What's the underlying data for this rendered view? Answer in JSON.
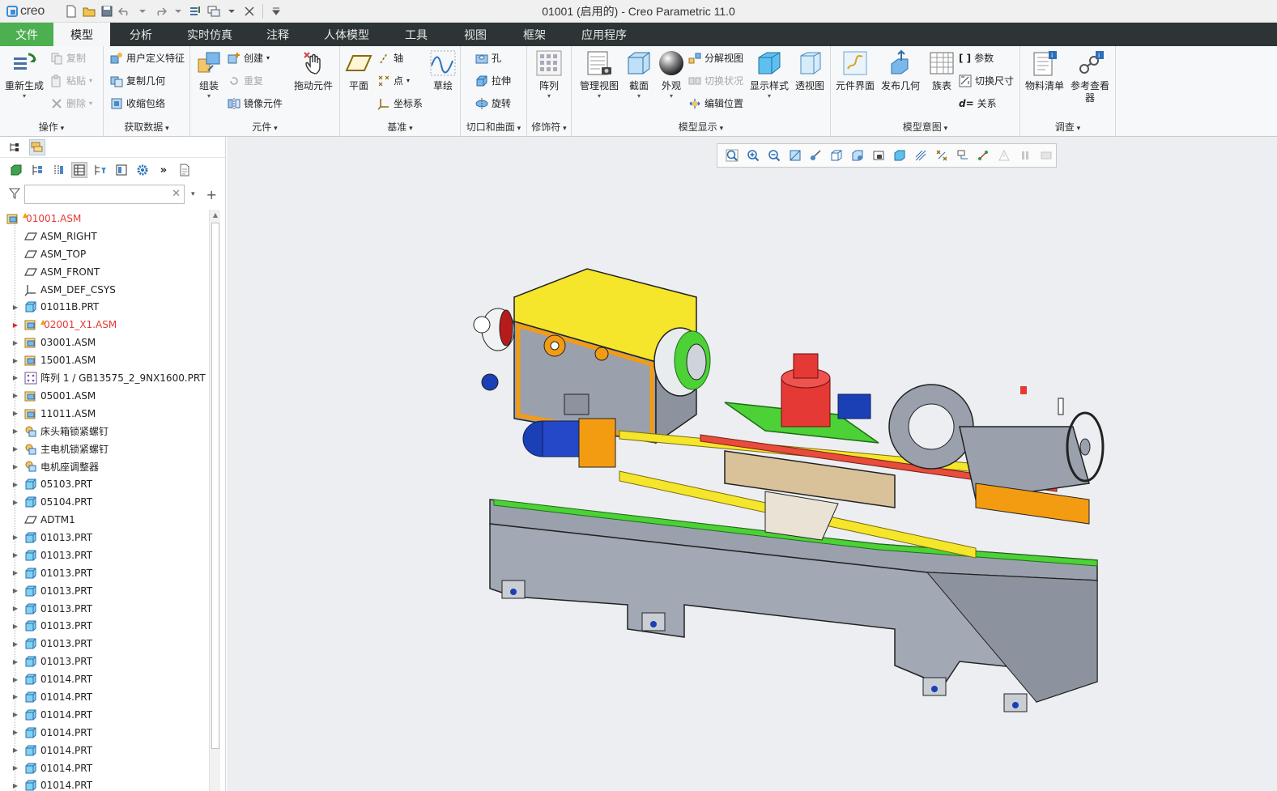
{
  "app": {
    "logo_text": "creo",
    "window_title": "01001 (启用的) - Creo Parametric 11.0"
  },
  "tabs": {
    "file": "文件",
    "items": [
      "模型",
      "分析",
      "实时仿真",
      "注释",
      "人体模型",
      "工具",
      "视图",
      "框架",
      "应用程序"
    ],
    "active": "模型"
  },
  "ribbon": {
    "operations": {
      "label": "操作",
      "regenerate": "重新生成",
      "copy": "复制",
      "paste": "粘贴",
      "delete": "删除"
    },
    "get_data": {
      "label": "获取数据",
      "user_feature": "用户定义特征",
      "copy_geometry": "复制几何",
      "shrinkwrap": "收缩包络"
    },
    "component": {
      "label": "元件",
      "assemble": "组装",
      "create": "创建",
      "repeat": "重复",
      "mirror_component": "镜像元件",
      "drag_components": "拖动元件"
    },
    "datum": {
      "label": "基准",
      "plane": "平面",
      "axis": "轴",
      "point": "点",
      "csys": "坐标系",
      "sketch": "草绘"
    },
    "cut_surface": {
      "label": "切口和曲面",
      "hole": "孔",
      "extrude": "拉伸",
      "revolve": "旋转"
    },
    "modifiers": {
      "label": "修饰符",
      "pattern": "阵列"
    },
    "model_display": {
      "label": "模型显示",
      "manage_views": "管理视图",
      "section": "截面",
      "appearance": "外观",
      "explode_view": "分解视图",
      "toggle_status": "切换状况",
      "edit_position": "编辑位置",
      "display_style": "显示样式",
      "perspective": "透视图"
    },
    "model_intent": {
      "label": "模型意图",
      "component_interface": "元件界面",
      "publish_geometry": "发布几何",
      "family_table": "族表",
      "parameters": "参数",
      "switch_dimensions": "切换尺寸",
      "relations": "关系"
    },
    "investigate": {
      "label": "调查",
      "bom": "物料清单",
      "reference_viewer": "参考查看器"
    }
  },
  "filter": {
    "placeholder": "",
    "value": ""
  },
  "tree": [
    {
      "label": "01001.ASM",
      "icon": "assembly-icon",
      "red": true,
      "warn": true,
      "root": true
    },
    {
      "label": "ASM_RIGHT",
      "icon": "datum-plane-icon"
    },
    {
      "label": "ASM_TOP",
      "icon": "datum-plane-icon"
    },
    {
      "label": "ASM_FRONT",
      "icon": "datum-plane-icon"
    },
    {
      "label": "ASM_DEF_CSYS",
      "icon": "csys-icon"
    },
    {
      "label": "01011B.PRT",
      "icon": "part-icon",
      "expand": true
    },
    {
      "label": "02001_X1.ASM",
      "icon": "assembly-icon",
      "expand": true,
      "red": true,
      "warn": true
    },
    {
      "label": "03001.ASM",
      "icon": "assembly-icon",
      "expand": true
    },
    {
      "label": "15001.ASM",
      "icon": "assembly-icon",
      "expand": true
    },
    {
      "label": "阵列 1 / GB13575_2_9NX1600.PRT",
      "icon": "pattern-icon",
      "expand": true
    },
    {
      "label": "05001.ASM",
      "icon": "assembly-icon",
      "expand": true
    },
    {
      "label": "11011.ASM",
      "icon": "assembly-icon",
      "expand": true
    },
    {
      "label": "床头箱锁紧螺钉",
      "icon": "group-icon",
      "expand": true
    },
    {
      "label": "主电机锁紧螺钉",
      "icon": "group-icon",
      "expand": true
    },
    {
      "label": "电机座调整器",
      "icon": "group-icon",
      "expand": true
    },
    {
      "label": "05103.PRT",
      "icon": "part-icon",
      "expand": true
    },
    {
      "label": "05104.PRT",
      "icon": "part-icon",
      "expand": true
    },
    {
      "label": "ADTM1",
      "icon": "datum-plane-icon"
    },
    {
      "label": "01013.PRT",
      "icon": "part-icon",
      "expand": true
    },
    {
      "label": "01013.PRT",
      "icon": "part-icon",
      "expand": true
    },
    {
      "label": "01013.PRT",
      "icon": "part-icon",
      "expand": true
    },
    {
      "label": "01013.PRT",
      "icon": "part-icon",
      "expand": true
    },
    {
      "label": "01013.PRT",
      "icon": "part-icon",
      "expand": true
    },
    {
      "label": "01013.PRT",
      "icon": "part-icon",
      "expand": true
    },
    {
      "label": "01013.PRT",
      "icon": "part-icon",
      "expand": true
    },
    {
      "label": "01013.PRT",
      "icon": "part-icon",
      "expand": true
    },
    {
      "label": "01014.PRT",
      "icon": "part-icon",
      "expand": true
    },
    {
      "label": "01014.PRT",
      "icon": "part-icon",
      "expand": true
    },
    {
      "label": "01014.PRT",
      "icon": "part-icon",
      "expand": true
    },
    {
      "label": "01014.PRT",
      "icon": "part-icon",
      "expand": true
    },
    {
      "label": "01014.PRT",
      "icon": "part-icon",
      "expand": true
    },
    {
      "label": "01014.PRT",
      "icon": "part-icon",
      "expand": true
    },
    {
      "label": "01014.PRT",
      "icon": "part-icon",
      "expand": true
    }
  ],
  "colors": {
    "file_tab": "#4caf50",
    "tab_bar": "#2d3436",
    "warning_text": "#e53935",
    "graphics_bg": "#edeef1"
  }
}
